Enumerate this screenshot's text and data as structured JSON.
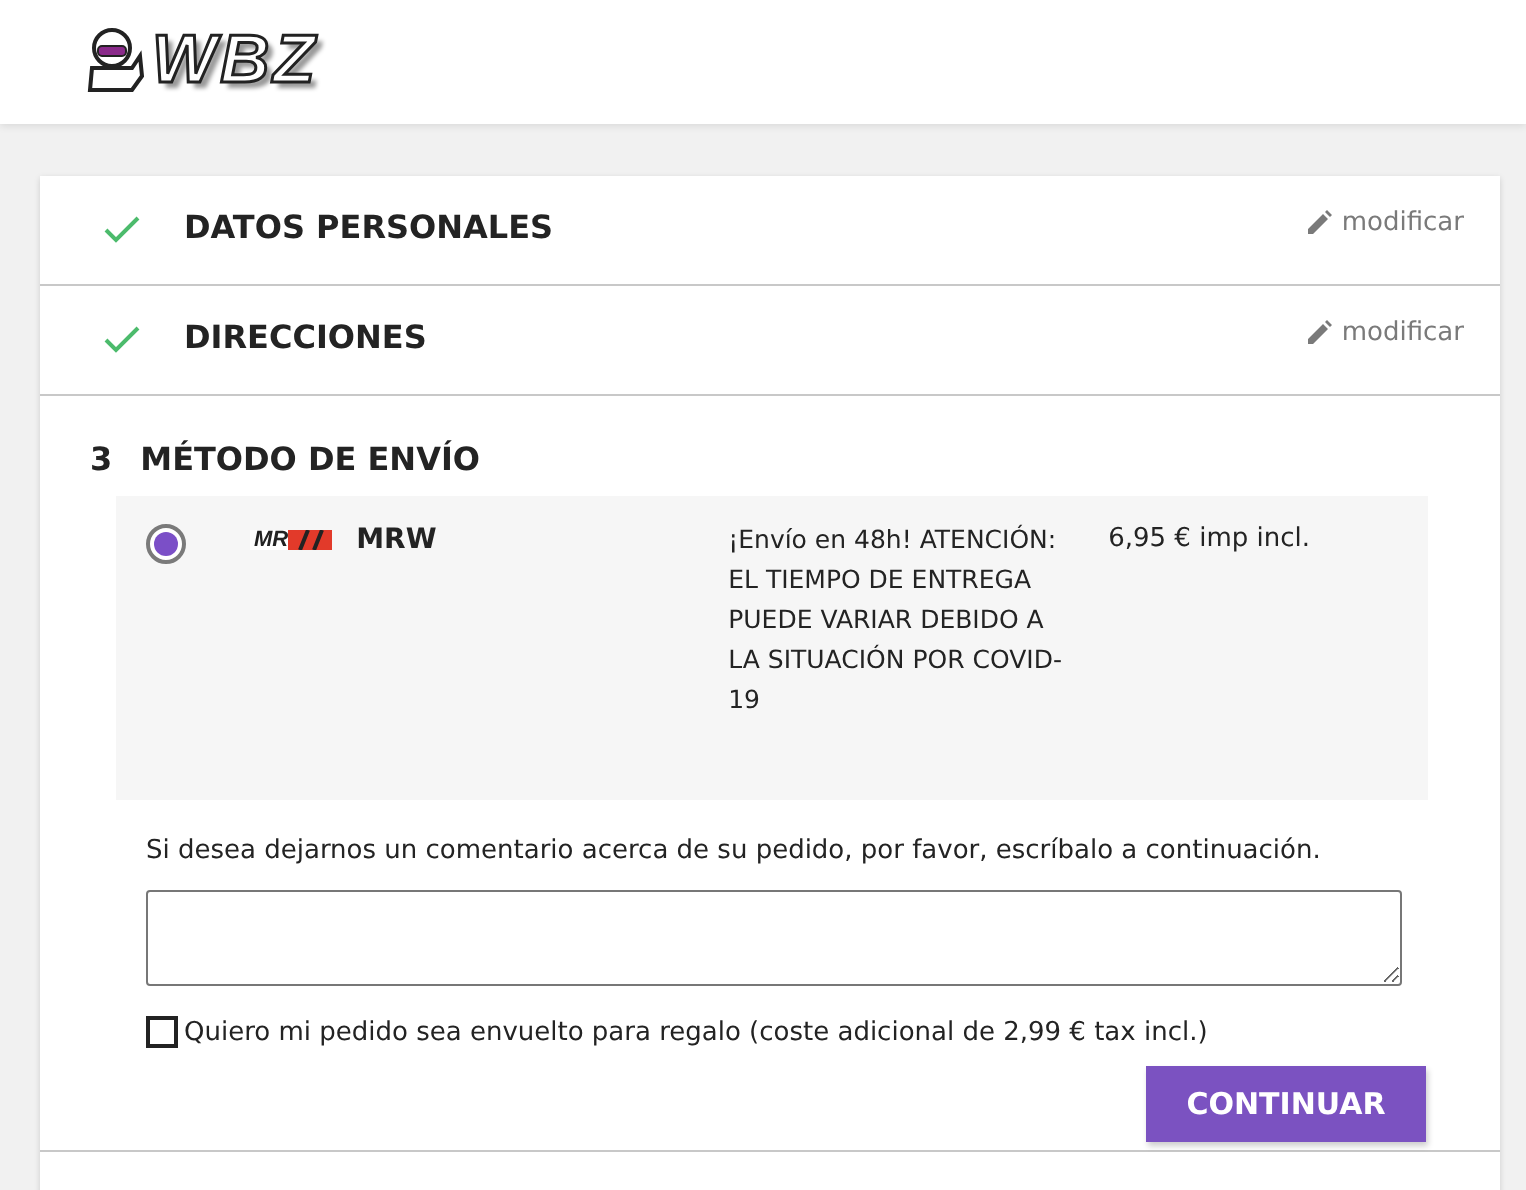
{
  "header": {
    "logo": "WBZ"
  },
  "steps": [
    {
      "title": "DATOS PERSONALES",
      "completed": true,
      "edit_label": "modificar"
    },
    {
      "title": "DIRECCIONES",
      "completed": true,
      "edit_label": "modificar"
    }
  ],
  "current_step": {
    "number": "3",
    "title": "MÉTODO DE ENVÍO",
    "carriers": [
      {
        "logo": "MR",
        "name": "MRW",
        "selected": true,
        "description": "¡Envío en 48h! ATENCIÓN: EL TIEMPO DE ENTREGA PUEDE VARIAR DEBIDO A LA SITUACIÓN POR COVID-19",
        "price": "6,95 € imp incl."
      }
    ],
    "comment_label": "Si desea dejarnos un comentario acerca de su pedido, por favor, escríbalo a continuación.",
    "gift": {
      "label": "Quiero mi pedido sea envuelto para regalo (coste adicional de 2,99 € tax incl.)",
      "checked": false
    },
    "button": "CONTINUAR"
  }
}
